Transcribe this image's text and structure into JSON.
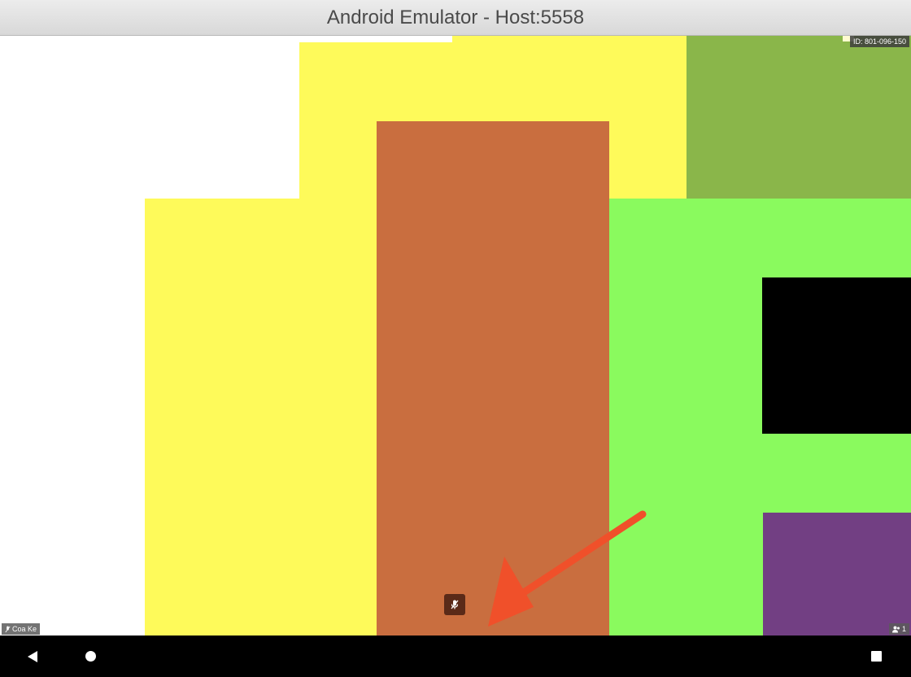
{
  "window": {
    "title": "Android Emulator - Host:5558"
  },
  "meeting": {
    "id_label": "ID: 801-096-150",
    "participant_name": "Coa Ke",
    "participant_count": "1"
  },
  "colors": {
    "yellow": "#fefa5a",
    "olive": "#8ab64a",
    "orange": "#c96e3f",
    "green": "#8afa5e",
    "black": "#000000",
    "purple": "#723f83",
    "annotation_arrow": "#f0502a"
  },
  "icons": {
    "mute": "microphone-muted-icon",
    "participants": "participants-icon",
    "name_mute": "microphone-muted-small-icon",
    "back": "back-triangle-icon",
    "home": "home-circle-icon",
    "recents": "recents-square-icon"
  }
}
